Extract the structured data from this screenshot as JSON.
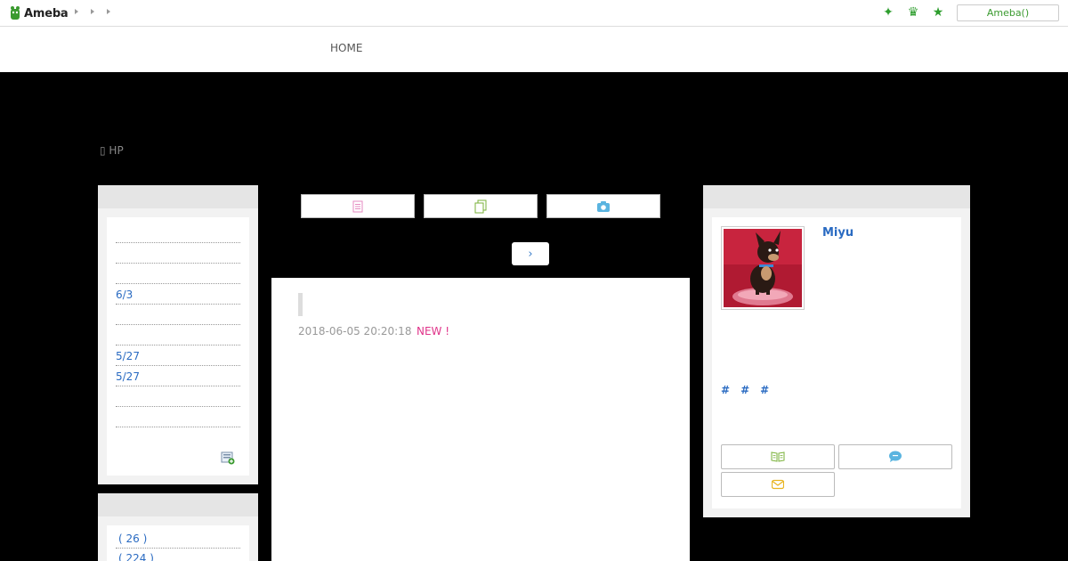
{
  "header": {
    "logo_text": "Ameba",
    "ameba_button": "Ameba()",
    "icons": [
      "sparkle-icon",
      "crown-icon",
      "star-icon"
    ]
  },
  "nav": {
    "home_label": "HOME"
  },
  "hp_link": "▯ HP",
  "left_sidebar": {
    "entries": [
      "",
      "",
      "",
      "6/3",
      "",
      "",
      "5/27",
      "5/27",
      "",
      ""
    ],
    "themes": [
      "( 26 )",
      "( 224 )"
    ]
  },
  "center": {
    "tab_icons": [
      "list-icon",
      "copy-icon",
      "camera-icon"
    ],
    "next_label": "›"
  },
  "article": {
    "date": "2018-06-05 20:20:18",
    "new_badge": "NEW !"
  },
  "profile": {
    "name": "Miyu",
    "hashtags": [
      "#",
      "#",
      "#"
    ],
    "buttons": [
      "book-icon",
      "chat-icon",
      "mail-icon"
    ]
  },
  "colors": {
    "accent_green": "#3a9a2f",
    "link_blue": "#2a6bc2",
    "new_pink": "#e0348a"
  }
}
